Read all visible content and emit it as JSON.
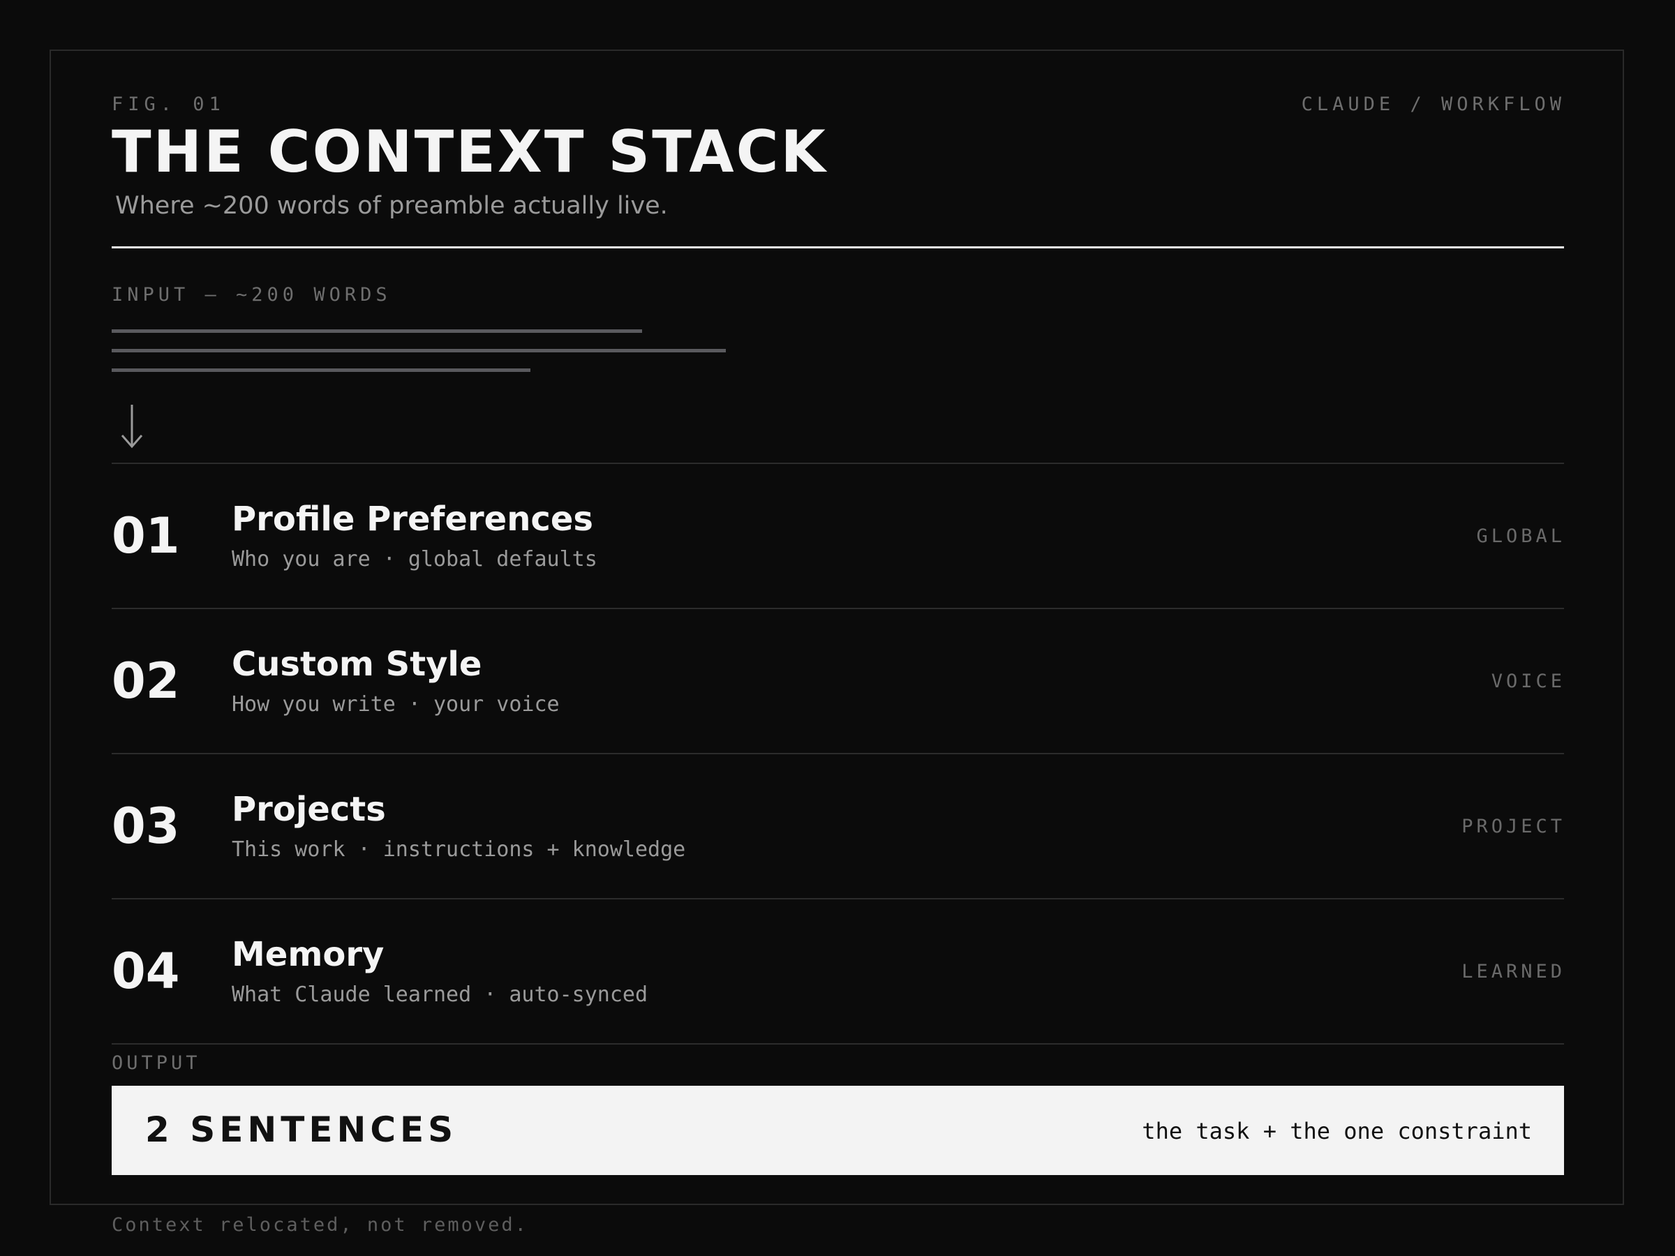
{
  "header": {
    "fig_label": "FIG. 01",
    "brand": "CLAUDE / WORKFLOW",
    "title": "THE CONTEXT STACK",
    "subtitle": "Where ~200 words of preamble actually live."
  },
  "input": {
    "label": "INPUT — ~200 WORDS",
    "lines": 3
  },
  "layers": [
    {
      "number": "01",
      "title": "Profile Preferences",
      "description": "Who you are · global defaults",
      "tag": "GLOBAL"
    },
    {
      "number": "02",
      "title": "Custom Style",
      "description": "How you write · your voice",
      "tag": "VOICE"
    },
    {
      "number": "03",
      "title": "Projects",
      "description": "This work · instructions + knowledge",
      "tag": "PROJECT"
    },
    {
      "number": "04",
      "title": "Memory",
      "description": "What Claude learned · auto-synced",
      "tag": "LEARNED"
    }
  ],
  "output": {
    "label": "OUTPUT",
    "main": "2 SENTENCES",
    "sub": "the task + the one constraint"
  },
  "footer": "Context relocated, not removed.",
  "colors": {
    "background": "#0b0b0b",
    "text_primary": "#f4f4f4",
    "text_secondary": "#9a9a9a",
    "text_muted": "#6e6e6e",
    "output_box": "#f3f3f3"
  },
  "icons": {
    "flow_arrow": "arrow-down-icon"
  }
}
